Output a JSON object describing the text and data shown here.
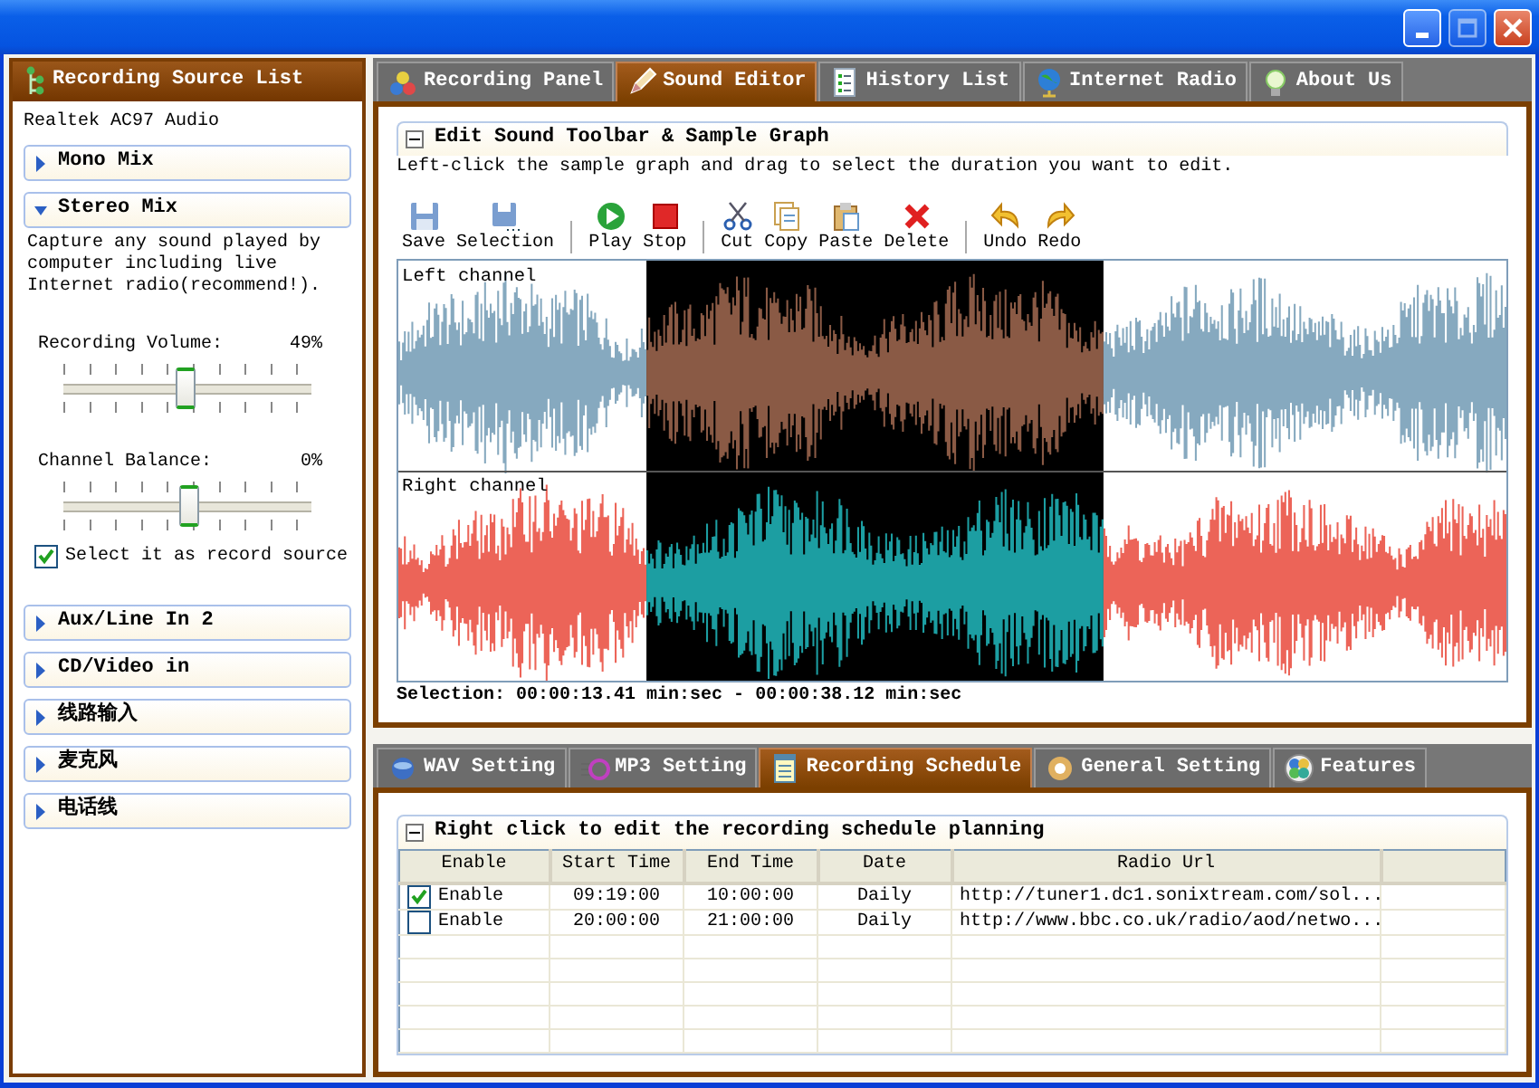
{
  "window": {
    "maximize_enabled": false
  },
  "source_panel": {
    "title": "Recording Source List",
    "device": "Realtek AC97 Audio",
    "sources": [
      {
        "name": "Mono Mix",
        "expanded": false
      },
      {
        "name": "Stereo Mix",
        "expanded": true,
        "description": "Capture any sound played by computer including live Internet radio(recommend!).",
        "sliders": [
          {
            "label": "Recording Volume:",
            "reading": "49%",
            "level": 0.49
          },
          {
            "label": "Channel Balance:",
            "reading": "0%",
            "level": 0.5
          }
        ],
        "record_source": {
          "label": "Select it as record source",
          "checked": true
        }
      },
      {
        "name": "Aux/Line In 2",
        "expanded": false
      },
      {
        "name": "CD/Video in",
        "expanded": false
      },
      {
        "name": "线路输入",
        "expanded": false
      },
      {
        "name": "麦克风",
        "expanded": false
      },
      {
        "name": "电话线",
        "expanded": false
      }
    ]
  },
  "editor": {
    "tabs": [
      {
        "label": "Recording Panel",
        "selected": false
      },
      {
        "label": "Sound Editor",
        "selected": true
      },
      {
        "label": "History List",
        "selected": false
      },
      {
        "label": "Internet Radio",
        "selected": false
      },
      {
        "label": "About Us",
        "selected": false
      }
    ],
    "group_title": "Edit Sound Toolbar & Sample Graph",
    "hint": "Left-click the sample graph and drag to select the duration you want to edit.",
    "toolbar": [
      {
        "label": "Save",
        "separator_after": false
      },
      {
        "label": "Selection",
        "separator_after": true
      },
      {
        "label": "Play",
        "separator_after": false
      },
      {
        "label": "Stop",
        "separator_after": true
      },
      {
        "label": "Cut",
        "separator_after": false
      },
      {
        "label": "Copy",
        "separator_after": false
      },
      {
        "label": "Paste",
        "separator_after": false
      },
      {
        "label": "Delete",
        "separator_after": true
      },
      {
        "label": "Undo",
        "separator_after": false
      },
      {
        "label": "Redo",
        "separator_after": false
      }
    ],
    "channels": [
      {
        "label": "Left channel"
      },
      {
        "label": "Right channel"
      }
    ],
    "selection": "Selection: 00:00:13.41 min:sec - 00:00:38.12 min:sec"
  },
  "settings": {
    "tabs": [
      {
        "label": "WAV Setting",
        "selected": false
      },
      {
        "label": "MP3 Setting",
        "selected": false
      },
      {
        "label": "Recording Schedule",
        "selected": true
      },
      {
        "label": "General Setting",
        "selected": false
      },
      {
        "label": "Features",
        "selected": false
      }
    ],
    "group_title": "Right click to edit the recording schedule planning",
    "table": {
      "columns": [
        "Enable",
        "Start Time",
        "End Time",
        "Date",
        "Radio Url"
      ],
      "rows": [
        {
          "enabled": true,
          "cells": [
            "Enable",
            "09:19:00",
            "10:00:00",
            "Daily",
            "http://tuner1.dc1.sonixtream.com/sol..."
          ]
        },
        {
          "enabled": false,
          "cells": [
            "Enable",
            "20:00:00",
            "21:00:00",
            "Daily",
            "http://www.bbc.co.uk/radio/aod/netwo..."
          ]
        }
      ]
    }
  }
}
